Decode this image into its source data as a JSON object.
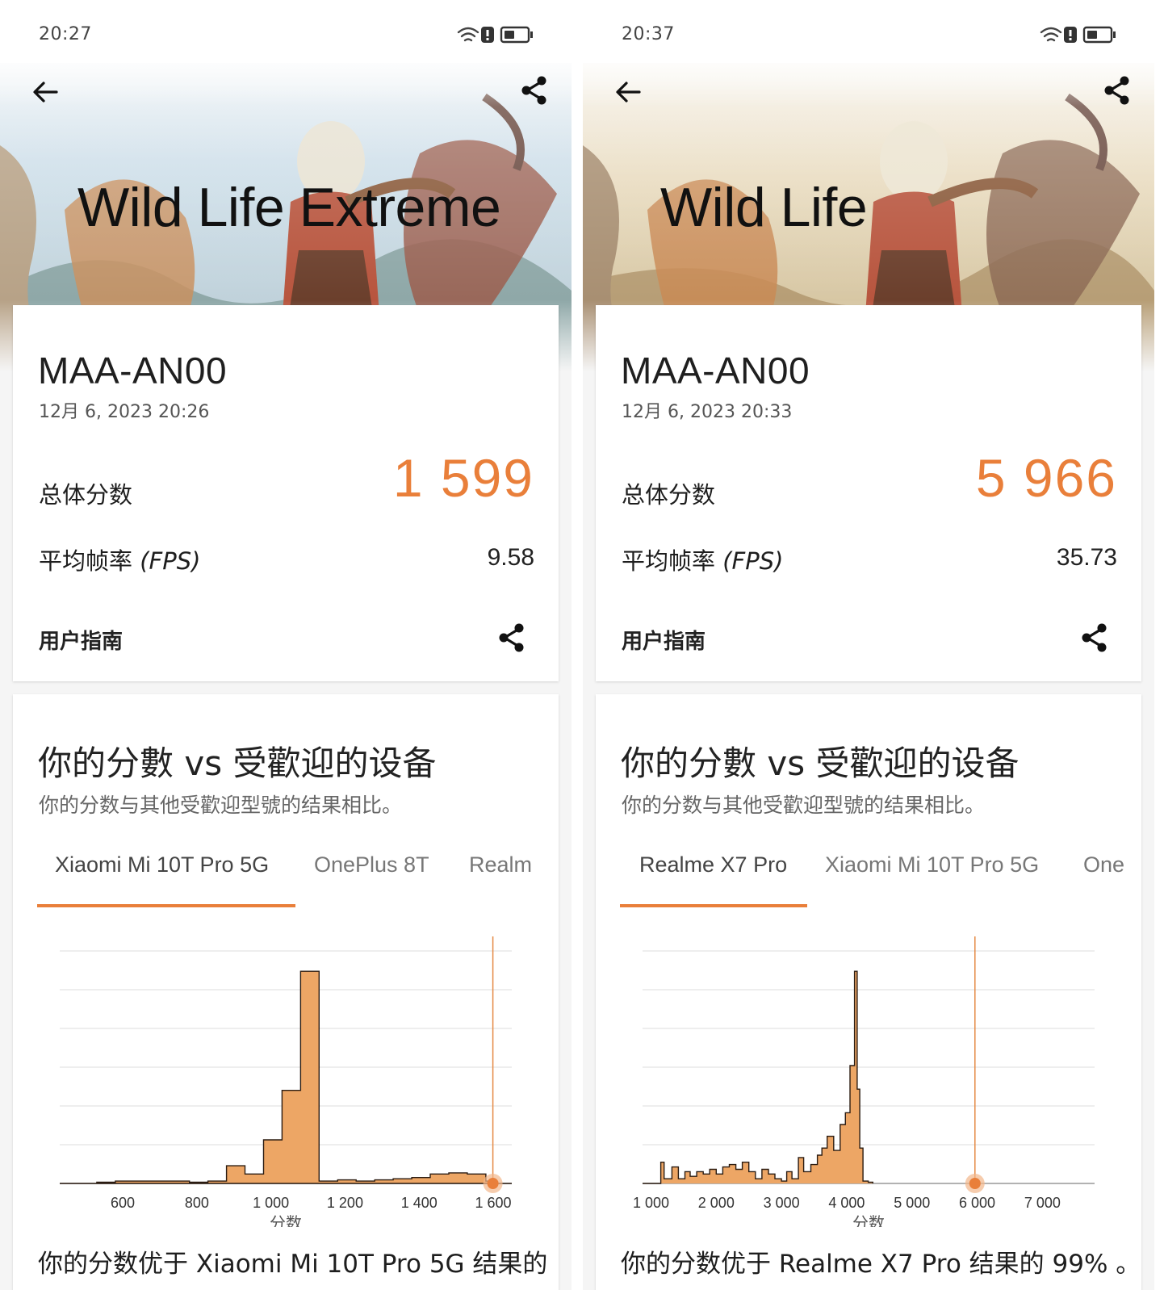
{
  "screens": [
    {
      "status_time": "20:27",
      "test_title": "Wild Life Extreme",
      "device_name": "MAA-AN00",
      "date": "12月 6, 2023 20:26",
      "score_label": "总体分数",
      "score": "1 599",
      "fps_label": "平均帧率",
      "fps_label_suffix": "(FPS)",
      "fps": "9.58",
      "guide_label": "用户指南",
      "compare_title": "你的分數 vs 受歡迎的设备",
      "compare_subtitle": "你的分数与其他受歡迎型號的结果相比。",
      "tabs": [
        "Xiaomi Mi 10T Pro 5G",
        "OnePlus 8T",
        "Realm"
      ],
      "active_tab": 0,
      "bottom_text": "你的分数优于 Xiaomi Mi 10T Pro 5G 结果的",
      "chart_data": {
        "type": "area",
        "xlabel": "分数",
        "xlim": [
          430,
          1650
        ],
        "xticks": [
          600,
          800,
          1000,
          1200,
          1400,
          1600
        ],
        "xtick_labels": [
          "600",
          "800",
          "1 000",
          "1 200",
          "1 400",
          "1 600"
        ],
        "marker_x": 1599,
        "grid": true,
        "series": [
          {
            "x": [
              430,
              530,
              530,
              580,
              580,
              780,
              780,
              830,
              830,
              880,
              880,
              930,
              930,
              980,
              980,
              1030,
              1030,
              1080,
              1080,
              1130,
              1130,
              1180,
              1180,
              1230,
              1230,
              1280,
              1280,
              1330,
              1330,
              1380,
              1380,
              1430,
              1430,
              1480,
              1480,
              1530,
              1530,
              1580,
              1580,
              1600,
              1600,
              1650
            ],
            "y": [
              0,
              0,
              0.5,
              0.5,
              1,
              1,
              0.5,
              0.5,
              1,
              1,
              7.5,
              7.5,
              4,
              4,
              18.5,
              18.5,
              39.5,
              39.5,
              90,
              90,
              1,
              1,
              1.5,
              1.5,
              1,
              1,
              1.5,
              1.5,
              2,
              2,
              2.5,
              2.5,
              4,
              4,
              4.5,
              4.5,
              4,
              4,
              1,
              1,
              0,
              0
            ]
          }
        ]
      }
    },
    {
      "status_time": "20:37",
      "test_title": "Wild Life",
      "device_name": "MAA-AN00",
      "date": "12月 6, 2023 20:33",
      "score_label": "总体分数",
      "score": "5 966",
      "fps_label": "平均帧率",
      "fps_label_suffix": "(FPS)",
      "fps": "35.73",
      "guide_label": "用户指南",
      "compare_title": "你的分數 vs 受歡迎的设备",
      "compare_subtitle": "你的分数与其他受歡迎型號的结果相比。",
      "tabs": [
        "Realme X7 Pro",
        "Xiaomi Mi 10T Pro 5G",
        "One"
      ],
      "active_tab": 0,
      "bottom_text": "你的分数优于 Realme X7 Pro 结果的 99% 。",
      "chart_data": {
        "type": "area",
        "xlabel": "分数",
        "xlim": [
          870,
          7800
        ],
        "xticks": [
          1000,
          2000,
          3000,
          4000,
          5000,
          6000,
          7000
        ],
        "xtick_labels": [
          "1 000",
          "2 000",
          "3 000",
          "4 000",
          "5 000",
          "6 000",
          "7 000"
        ],
        "marker_x": 5966,
        "grid": true,
        "series": [
          {
            "x": [
              870,
              1150,
              1150,
              1200,
              1200,
              1320,
              1320,
              1420,
              1420,
              1520,
              1520,
              1600,
              1600,
              1700,
              1700,
              1800,
              1800,
              1900,
              1900,
              2000,
              2000,
              2100,
              2100,
              2200,
              2200,
              2300,
              2300,
              2400,
              2400,
              2500,
              2500,
              2600,
              2600,
              2700,
              2700,
              2800,
              2800,
              2900,
              2900,
              3000,
              3000,
              3080,
              3080,
              3160,
              3160,
              3260,
              3260,
              3340,
              3340,
              3450,
              3450,
              3550,
              3550,
              3620,
              3620,
              3700,
              3700,
              3800,
              3800,
              3900,
              3900,
              3980,
              3980,
              4050,
              4050,
              4120,
              4120,
              4160,
              4160,
              4200,
              4200,
              4250,
              4250,
              4330,
              4330,
              4400,
              4400,
              7800
            ],
            "y": [
              0,
              0,
              9,
              9,
              2,
              2,
              7,
              7,
              2,
              2,
              5,
              5,
              3,
              3,
              5,
              5,
              4,
              4,
              6,
              6,
              4,
              4,
              7,
              7,
              8,
              8,
              6,
              6,
              9,
              9,
              5,
              5,
              2,
              2,
              6,
              6,
              4,
              4,
              2,
              2,
              1,
              1,
              5,
              5,
              2,
              2,
              11,
              11,
              5,
              5,
              8,
              8,
              12,
              12,
              15,
              15,
              20,
              20,
              14,
              14,
              25,
              25,
              30,
              30,
              50,
              50,
              90,
              90,
              40,
              40,
              15,
              15,
              1,
              1,
              0.5,
              0.5,
              0
            ]
          }
        ]
      }
    }
  ]
}
